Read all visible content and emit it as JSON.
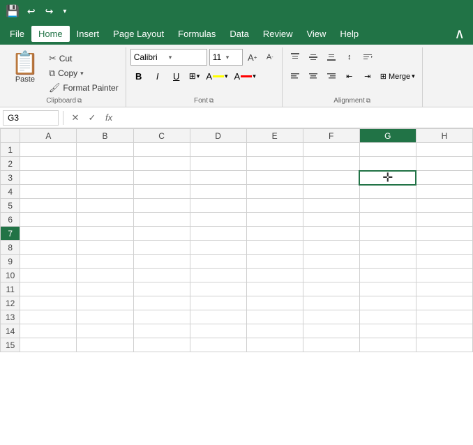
{
  "titlebar": {
    "save_icon": "💾",
    "undo_icon": "↩",
    "redo_icon": "↪",
    "more_icon": "▾"
  },
  "menubar": {
    "items": [
      "File",
      "Home",
      "Insert",
      "Page Layout",
      "Formulas",
      "Data",
      "Review",
      "View",
      "Help"
    ],
    "active": "Home"
  },
  "ribbon": {
    "clipboard": {
      "label": "Clipboard",
      "paste_label": "Paste",
      "cut_label": "Cut",
      "copy_label": "Copy",
      "format_painter_label": "Format Painter"
    },
    "font": {
      "label": "Font",
      "font_name": "Calibri",
      "font_size": "11",
      "bold_label": "B",
      "italic_label": "I",
      "underline_label": "U",
      "increase_size_label": "A",
      "decrease_size_label": "A"
    },
    "alignment": {
      "label": "Alignment"
    }
  },
  "formulabar": {
    "cell_ref": "G3",
    "cancel_label": "✕",
    "confirm_label": "✓",
    "fx_label": "fx"
  },
  "spreadsheet": {
    "columns": [
      "A",
      "B",
      "C",
      "D",
      "E",
      "F",
      "G",
      "H"
    ],
    "rows": [
      1,
      2,
      3,
      4,
      5,
      6,
      7,
      8,
      9,
      10,
      11,
      12,
      13,
      14,
      15
    ],
    "selected_cell": {
      "col": "G",
      "col_index": 6,
      "row": 3
    },
    "active_row": 7
  },
  "colors": {
    "excel_green": "#217346",
    "ribbon_bg": "#f3f3f3",
    "border": "#d0d0d0",
    "header_bg": "#f3f3f3"
  }
}
